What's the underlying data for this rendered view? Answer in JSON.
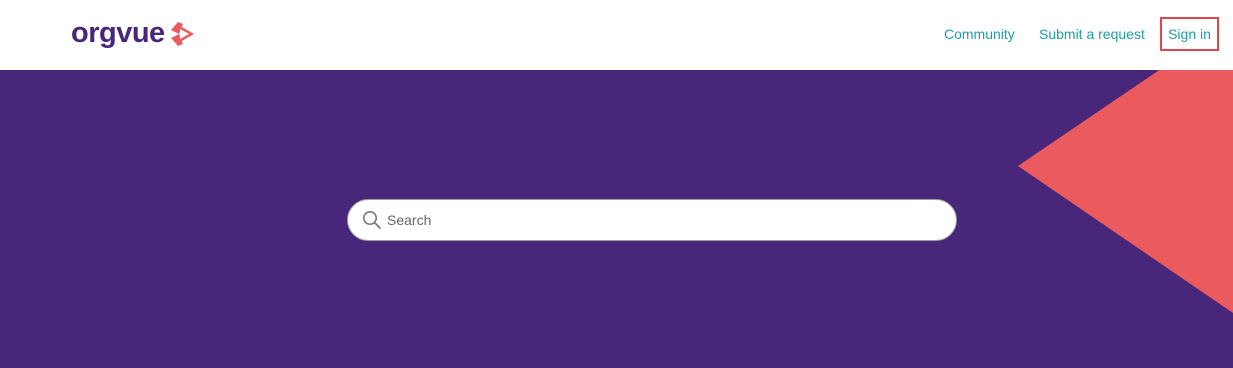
{
  "header": {
    "logo_text": "orgvue",
    "nav": {
      "community": "Community",
      "submit_request": "Submit a request",
      "sign_in": "Sign in"
    }
  },
  "hero": {
    "search": {
      "placeholder": "Search",
      "value": ""
    }
  },
  "colors": {
    "brand_purple": "#48277a",
    "accent_coral": "#eb5b5e",
    "link_teal": "#1f9ea5",
    "highlight_red": "#e0464b"
  },
  "icons": {
    "logo_mark": "orgvue-arrow-logo-icon",
    "search": "search-icon"
  }
}
